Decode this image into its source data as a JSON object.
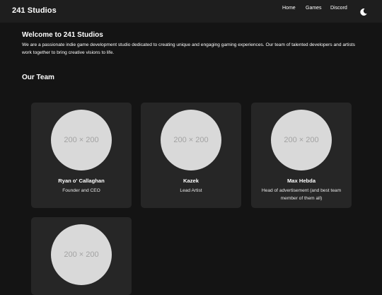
{
  "nav": {
    "brand": "241 Studios",
    "links": [
      "Home",
      "Games",
      "Discord"
    ],
    "theme_icon": "moon-icon"
  },
  "welcome": {
    "title": "Welcome to 241 Studios",
    "text": "We are a passionate indie game development studio dedicated to creating unique and engaging gaming experiences. Our team of talented developers and artists work together to bring creative visions to life."
  },
  "team": {
    "title": "Our Team",
    "placeholder": "200 × 200",
    "members": [
      {
        "name": "Ryan o' Callaghan",
        "role": "Founder and CEO"
      },
      {
        "name": "Kazek",
        "role": "Lead Artist"
      },
      {
        "name": "Max Hebda",
        "role": "Head of advertisement (and best team member of them all)"
      },
      {
        "name": "",
        "role": ""
      }
    ]
  },
  "colors": {
    "background": "#141414",
    "navbar": "#1e1e1e",
    "card": "#262626",
    "placeholder": "#d9d9d9"
  }
}
